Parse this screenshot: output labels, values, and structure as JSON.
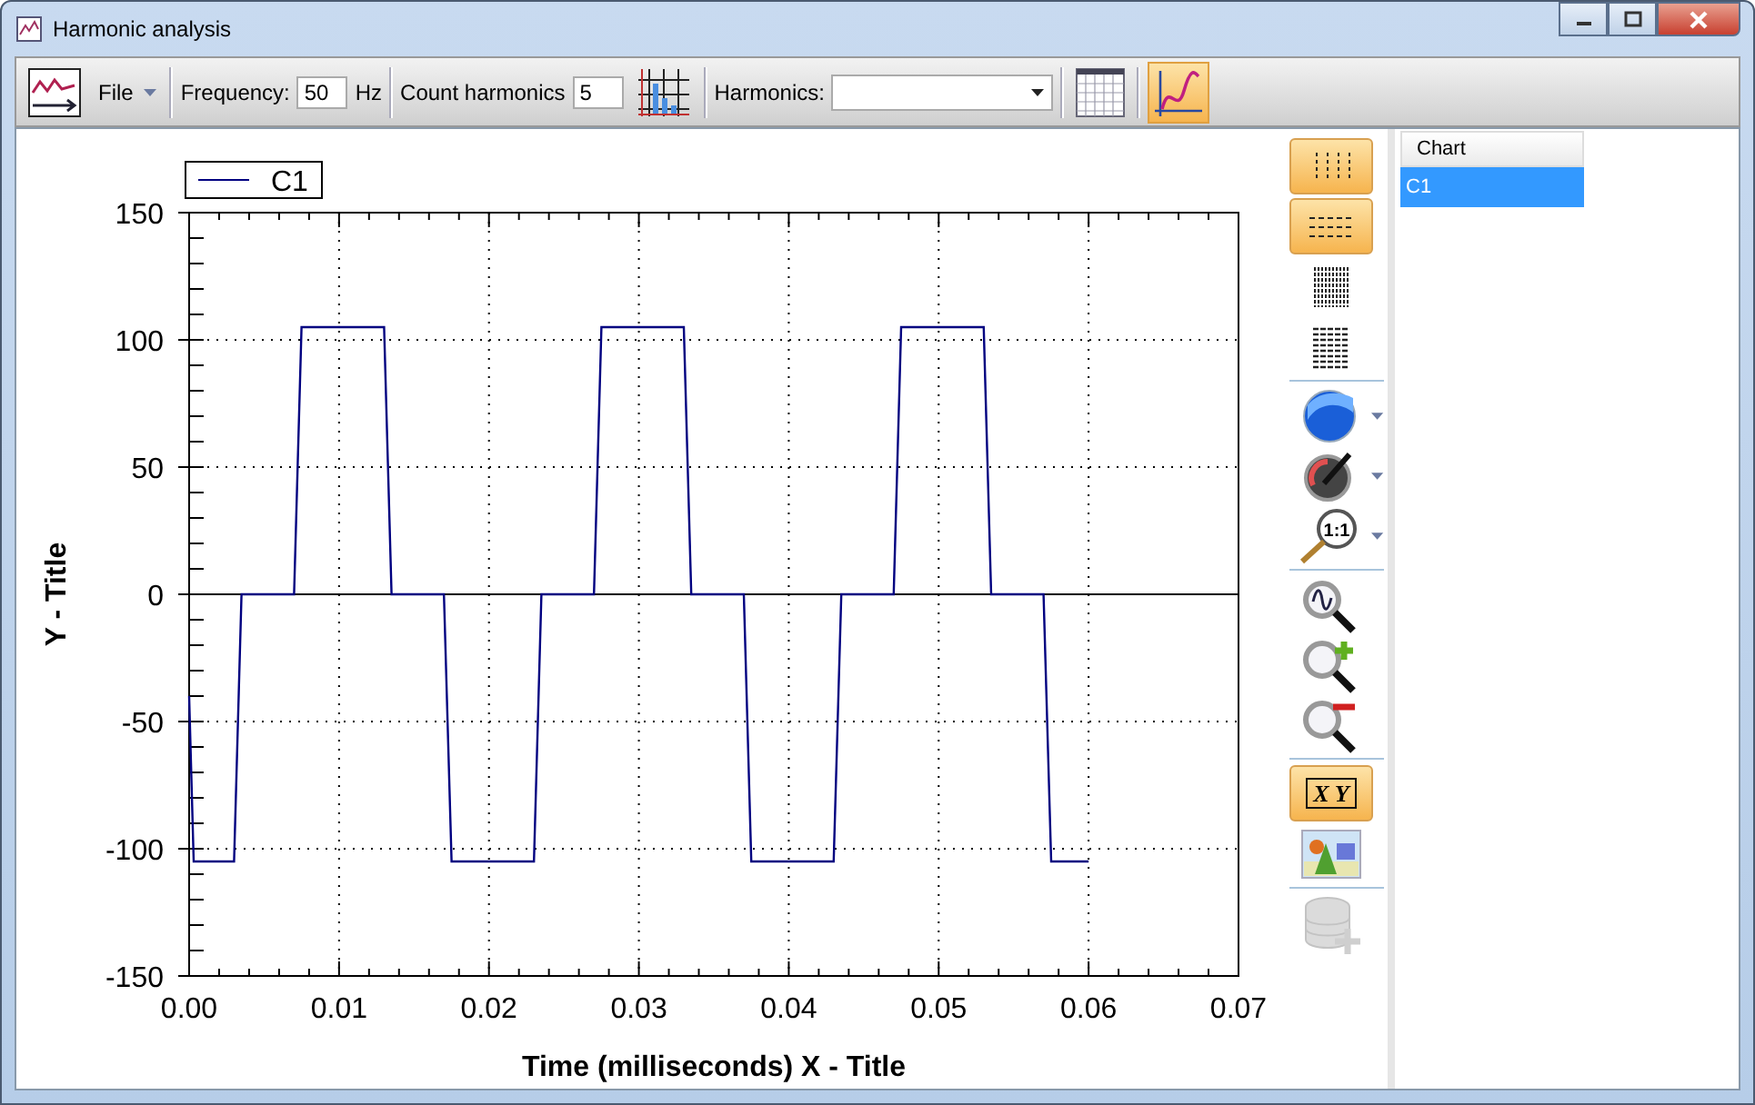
{
  "window": {
    "title": "Harmonic analysis"
  },
  "toolbar": {
    "chart_button": {
      "selected": false
    },
    "file_menu": "File",
    "frequency": {
      "label": "Frequency:",
      "value": "50",
      "unit": "Hz"
    },
    "count_harmonics": {
      "label": "Count harmonics",
      "value": "5"
    },
    "harmonics_button": {
      "selected": false
    },
    "harmonics": {
      "label": "Harmonics:"
    },
    "grid_button": {
      "selected": false
    },
    "curve_button": {
      "selected": true
    }
  },
  "side_tools": [
    {
      "kind": "vgrid",
      "selected": true,
      "dropdown": false,
      "disabled": false,
      "separator_after": false
    },
    {
      "kind": "hgrid",
      "selected": true,
      "dropdown": false,
      "disabled": false,
      "separator_after": false
    },
    {
      "kind": "finev",
      "selected": false,
      "dropdown": false,
      "disabled": false,
      "separator_after": false
    },
    {
      "kind": "fineh",
      "selected": false,
      "dropdown": false,
      "disabled": false,
      "separator_after": true
    },
    {
      "kind": "sphere",
      "selected": false,
      "dropdown": true,
      "disabled": false,
      "separator_after": false
    },
    {
      "kind": "gauge",
      "selected": false,
      "dropdown": true,
      "disabled": false,
      "separator_after": false
    },
    {
      "kind": "zoom11",
      "label": "1:1",
      "selected": false,
      "dropdown": true,
      "disabled": false,
      "separator_after": true
    },
    {
      "kind": "zoomwave",
      "selected": false,
      "dropdown": false,
      "disabled": false,
      "separator_after": false
    },
    {
      "kind": "zoomin",
      "selected": false,
      "dropdown": false,
      "disabled": false,
      "separator_after": false
    },
    {
      "kind": "zoomout",
      "selected": false,
      "dropdown": false,
      "disabled": false,
      "separator_after": true
    },
    {
      "kind": "xy",
      "label": "X Y",
      "selected": true,
      "dropdown": false,
      "disabled": false,
      "separator_after": false
    },
    {
      "kind": "image",
      "selected": false,
      "dropdown": false,
      "disabled": false,
      "separator_after": true
    },
    {
      "kind": "dbadd",
      "selected": false,
      "dropdown": false,
      "disabled": true,
      "separator_after": false
    }
  ],
  "series_list": {
    "column": "Chart",
    "rows": [
      {
        "label": "C1",
        "selected": true
      }
    ]
  },
  "chart_data": {
    "type": "line",
    "xlabel": "Time (milliseconds) X - Title",
    "ylabel": "Y - Title",
    "x": [
      0,
      0.0003,
      0.003,
      0.0035,
      0.007,
      0.0075,
      0.013,
      0.0135,
      0.017,
      0.0175,
      0.023,
      0.0235,
      0.027,
      0.0275,
      0.033,
      0.0335,
      0.037,
      0.0375,
      0.043,
      0.0435,
      0.047,
      0.0475,
      0.053,
      0.0535,
      0.057,
      0.0575,
      0.06
    ],
    "series": [
      {
        "name": "C1",
        "color": "#000080",
        "values": [
          -40,
          -105,
          -105,
          0,
          0,
          105,
          105,
          0,
          0,
          -105,
          -105,
          0,
          0,
          105,
          105,
          0,
          0,
          -105,
          -105,
          0,
          0,
          105,
          105,
          0,
          0,
          -105,
          -105
        ]
      }
    ],
    "grid": true,
    "xlim": [
      0,
      0.07
    ],
    "ylim": [
      -150,
      150
    ],
    "xticks": [
      {
        "value": 0,
        "label": "0.00"
      },
      {
        "value": 0.01,
        "label": "0.01"
      },
      {
        "value": 0.02,
        "label": "0.02"
      },
      {
        "value": 0.03,
        "label": "0.03"
      },
      {
        "value": 0.04,
        "label": "0.04"
      },
      {
        "value": 0.05,
        "label": "0.05"
      },
      {
        "value": 0.06,
        "label": "0.06"
      },
      {
        "value": 0.07,
        "label": "0.07"
      }
    ],
    "yticks": [
      -150,
      -100,
      -50,
      0,
      50,
      100,
      150
    ]
  }
}
